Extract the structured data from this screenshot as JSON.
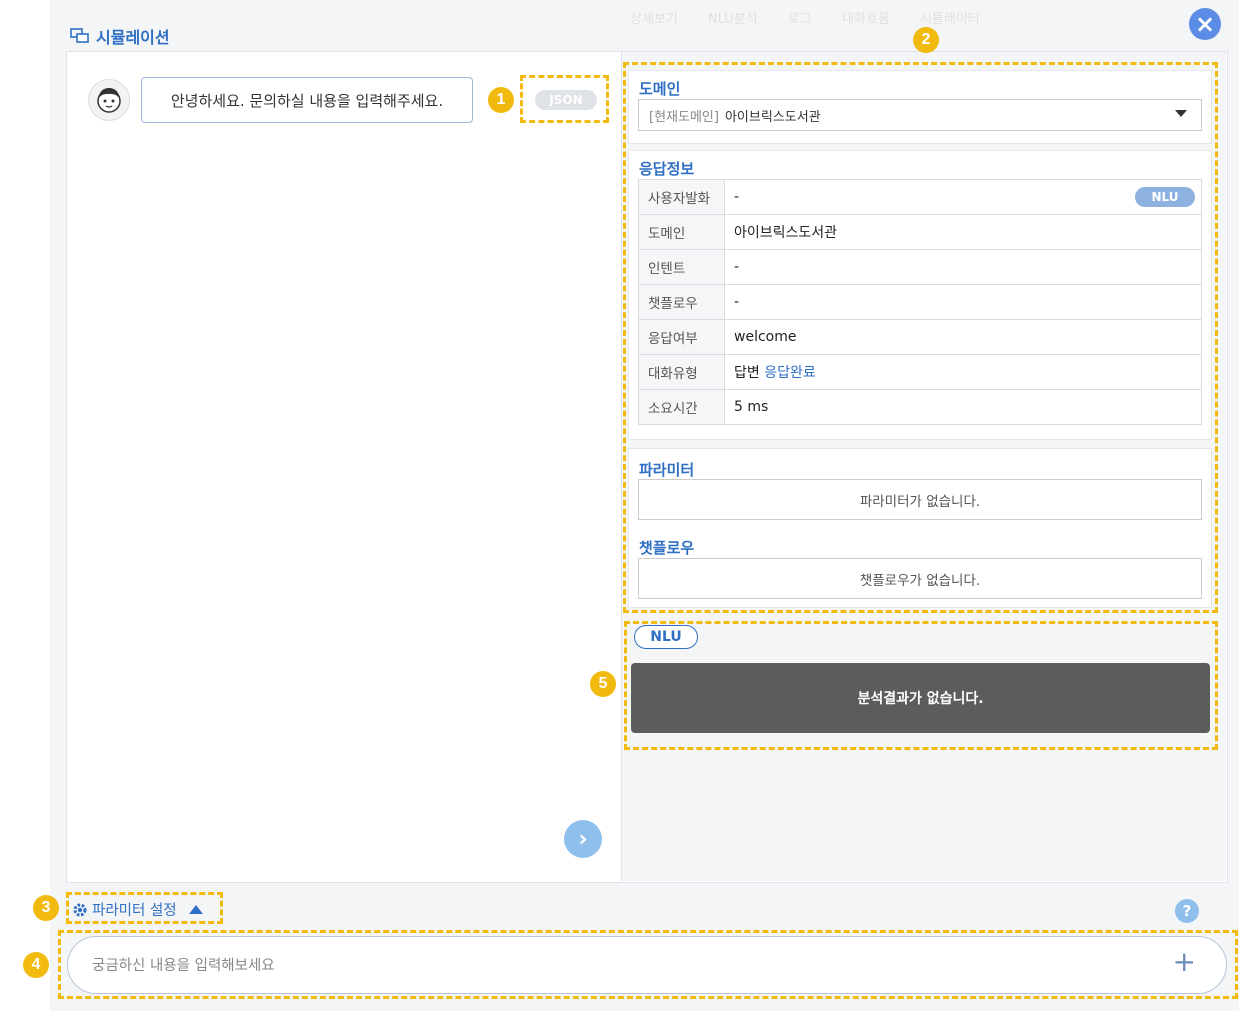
{
  "header": {
    "title": "시뮬레이션",
    "faint_tabs": [
      "상세보기",
      "NLU분석",
      "로그",
      "대화흐름",
      "시뮬레이터"
    ]
  },
  "chat": {
    "greeting": "안녕하세요. 문의하실 내용을 입력해주세요.",
    "json_badge": "JSON"
  },
  "domain": {
    "label": "도메인",
    "prefix": "[현재도메인]",
    "value": "아이브릭스도서관"
  },
  "response_info": {
    "label": "응답정보",
    "nlu_badge": "NLU",
    "rows": [
      {
        "key": "사용자발화",
        "value": "-"
      },
      {
        "key": "도메인",
        "value": "아이브릭스도서관"
      },
      {
        "key": "인텐트",
        "value": "-"
      },
      {
        "key": "챗플로우",
        "value": "-"
      },
      {
        "key": "응답여부",
        "value": "welcome"
      },
      {
        "key": "대화유형",
        "value": "답변",
        "value_extra": "응답완료"
      },
      {
        "key": "소요시간",
        "value": "5 ms"
      }
    ]
  },
  "parameters": {
    "label": "파라미터",
    "empty": "파라미터가 없습니다."
  },
  "chatflow": {
    "label": "챗플로우",
    "empty": "챗플로우가 없습니다."
  },
  "nlu": {
    "tag": "NLU",
    "empty": "분석결과가 없습니다."
  },
  "bottom": {
    "param_setting": "파라미터 설정",
    "input_placeholder": "궁금하신 내용을 입력해보세요",
    "input_value": ""
  },
  "annotations": [
    "1",
    "2",
    "3",
    "4",
    "5"
  ],
  "colors": {
    "accent": "#2f6fc4",
    "annotation": "#f2b90f",
    "analysis_bg": "#5c5c5c"
  }
}
